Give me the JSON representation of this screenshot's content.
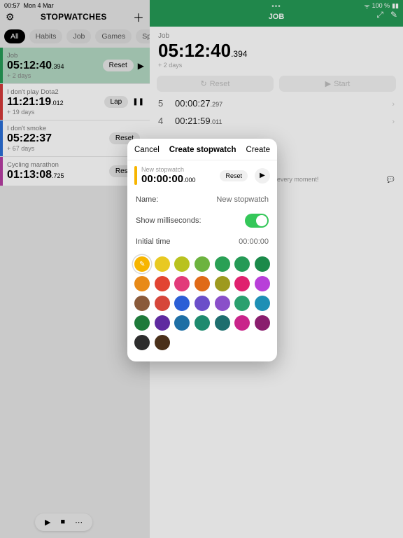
{
  "status": {
    "time": "00:57",
    "date": "Mon 4 Mar",
    "battery": "100 %"
  },
  "left": {
    "title": "STOPWATCHES",
    "tabs": [
      "All",
      "Habits",
      "Job",
      "Games",
      "Sport"
    ],
    "items": [
      {
        "label": "Job",
        "time": "05:12:40",
        "ms": ".394",
        "extra": "+ 2 days",
        "btn": "Reset",
        "icon": "▶",
        "color": "#259a56",
        "selected": true
      },
      {
        "label": "I don't play Dota2",
        "time": "11:21:19",
        "ms": ".012",
        "extra": "+ 19 days",
        "btn": "Lap",
        "icon": "❚❚",
        "color": "#d33a3a"
      },
      {
        "label": "I don't smoke",
        "time": "05:22:37",
        "ms": "",
        "extra": "+ 67 days",
        "btn": "Reset",
        "icon": "",
        "color": "#2b6fd6"
      },
      {
        "label": "Cycling marathon",
        "time": "01:13:08",
        "ms": ".725",
        "extra": "",
        "btn": "Reset",
        "icon": "",
        "color": "#b53ea2"
      }
    ]
  },
  "right": {
    "title": "JOB",
    "label": "Job",
    "time": "05:12:40",
    "ms": ".394",
    "extra": "+ 2 days",
    "reset": "Reset",
    "start": "Start",
    "laps": [
      {
        "idx": "5",
        "t": "00:00:27",
        "ms": ".297"
      },
      {
        "idx": "4",
        "t": "00:21:59",
        "ms": ".011"
      }
    ],
    "memo": "lized memories in every moment!"
  },
  "modal": {
    "cancel": "Cancel",
    "title": "Create stopwatch",
    "create": "Create",
    "preview_label": "New stopwatch",
    "preview_time": "00:00:00",
    "preview_ms": ".000",
    "reset": "Reset",
    "name_label": "Name:",
    "name_value": "New stopwatch",
    "ms_label": "Show milliseconds:",
    "init_label": "Initial time",
    "init_value": "00:00:00",
    "colors": [
      "#f7b500",
      "#e8c922",
      "#b9c21f",
      "#6db33f",
      "#2aa055",
      "#259a56",
      "#1b8a4a",
      "#e88a17",
      "#e24432",
      "#e23b7a",
      "#e06a17",
      "#9e9a1f",
      "#e0216e",
      "#b83fd9",
      "#8a5a3a",
      "#d6463a",
      "#2b5fd6",
      "#6b4fc9",
      "#8a4fc9",
      "#2aa06e",
      "#1e8fb5",
      "#1e7a3a",
      "#5f2aa0",
      "#1e6fa5",
      "#1e8a6e",
      "#1e6e6e",
      "#c9248a",
      "#8a1e6e",
      "#2d2d2d",
      "#4a301a"
    ]
  },
  "bottom": {
    "play": "▶",
    "stop": "■",
    "more": "⋯"
  }
}
